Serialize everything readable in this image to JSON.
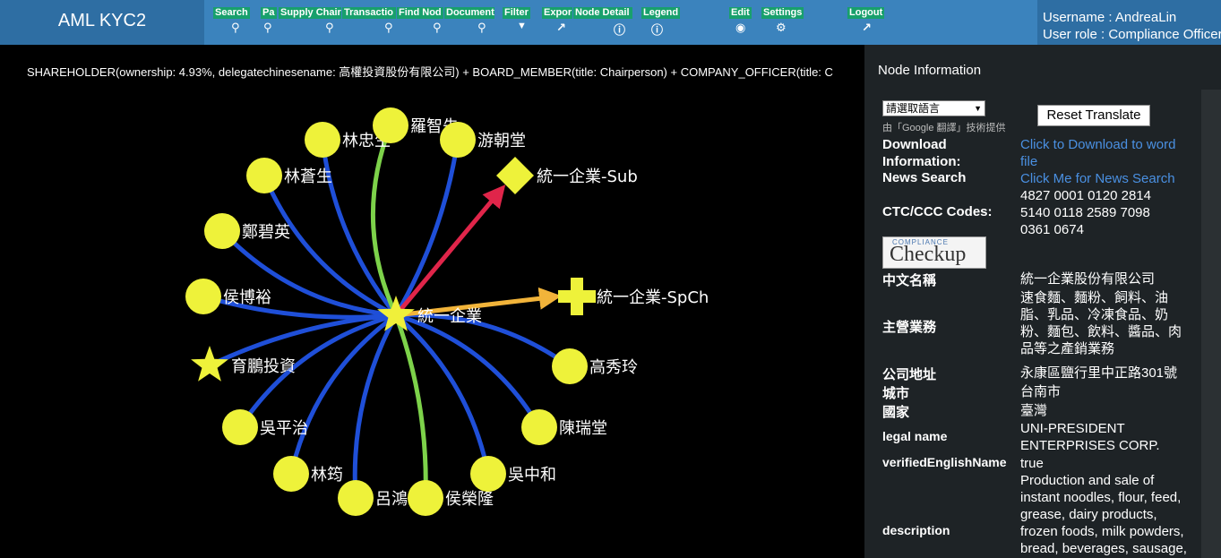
{
  "app": {
    "title": "AML KYC2"
  },
  "toolbar": {
    "items": [
      {
        "label": "Search",
        "icon": "search-icon",
        "glyph": "⚲"
      },
      {
        "label": "Pa",
        "icon": "search-icon",
        "glyph": "⚲"
      },
      {
        "label": "Supply Chair",
        "icon": "search-icon",
        "glyph": "⚲"
      },
      {
        "label": "Transactio",
        "icon": "search-icon",
        "glyph": "⚲"
      },
      {
        "label": "Find Nod",
        "icon": "search-icon",
        "glyph": "⚲"
      },
      {
        "label": "Document",
        "icon": "search-icon",
        "glyph": "⚲"
      },
      {
        "label": "Filter",
        "icon": "filter-icon",
        "glyph": "▼"
      },
      {
        "label": "Expor",
        "icon": "external-link-icon",
        "glyph": "↗"
      },
      {
        "label": "Node Detail",
        "icon": "info-icon",
        "glyph": "ⓘ"
      },
      {
        "label": "Legend",
        "icon": "info-icon",
        "glyph": "ⓘ"
      },
      {
        "label": "Edit",
        "icon": "edit-circle-icon",
        "glyph": "◉"
      },
      {
        "label": "Settings",
        "icon": "gears-icon",
        "glyph": "⚙"
      },
      {
        "label": "Logout",
        "icon": "external-link-icon",
        "glyph": "↗"
      }
    ]
  },
  "user": {
    "username_line": "Username : AndreaLin",
    "role_line": "User role   : Compliance Officer"
  },
  "query_text": "SHAREHOLDER(ownership: 4.93%, delegatechinesename: 高權投資股份有限公司) + BOARD_MEMBER(title: Chairperson) + COMPANY_OFFICER(title: C",
  "graph": {
    "center": {
      "label": "統一企業",
      "color": "#f0f03a"
    },
    "colors": {
      "node": "#eef23a",
      "edge_blue": "#1f4fd8",
      "edge_green": "#7dd24a",
      "edge_red": "#e0254a",
      "edge_orange": "#f2b43a"
    },
    "nodes": [
      {
        "label": "林忠生",
        "shape": "circle"
      },
      {
        "label": "羅智先",
        "shape": "circle"
      },
      {
        "label": "游朝堂",
        "shape": "circle"
      },
      {
        "label": "林蒼生",
        "shape": "circle"
      },
      {
        "label": "鄭碧英",
        "shape": "circle"
      },
      {
        "label": "侯博裕",
        "shape": "circle"
      },
      {
        "label": "育鵬投資",
        "shape": "star"
      },
      {
        "label": "吳平治",
        "shape": "circle"
      },
      {
        "label": "林筠",
        "shape": "circle"
      },
      {
        "label": "呂鴻德",
        "shape": "circle"
      },
      {
        "label": "侯榮隆",
        "shape": "circle"
      },
      {
        "label": "吳中和",
        "shape": "circle"
      },
      {
        "label": "陳瑞堂",
        "shape": "circle"
      },
      {
        "label": "高秀玲",
        "shape": "circle"
      },
      {
        "label": "統一企業-Sub",
        "shape": "diamond"
      },
      {
        "label": "統一企業-SpCh",
        "shape": "cross"
      }
    ]
  },
  "panel": {
    "title": "Node Information",
    "language_select": "請選取語言",
    "powered_by": "由「Google 翻譯」技術提供",
    "reset_button": "Reset Translate",
    "checkup_small": "COMPLIANCE",
    "checkup_big": "Checkup",
    "rows": [
      {
        "label": "Download Information:",
        "value": "Click to Download to word file",
        "link": true
      },
      {
        "label": "News Search",
        "value": "Click Me for News Search",
        "link": true
      },
      {
        "label": "CTC/CCC Codes:",
        "value": "4827 0001 0120 2814 5140 0118 2589 7098 0361 0674",
        "link": false
      },
      {
        "label": "中文名稱",
        "value": "統一企業股份有限公司",
        "link": false
      },
      {
        "label": "主營業務",
        "value": "速食麵、麵粉、飼料、油脂、乳品、冷凍食品、奶粉、麵包、飲料、醬品、肉品等之產銷業務",
        "link": false
      },
      {
        "label": "公司地址",
        "value": "永康區鹽行里中正路301號",
        "link": false
      },
      {
        "label": "城市",
        "value": "台南市",
        "link": false
      },
      {
        "label": "國家",
        "value": "臺灣",
        "link": false
      },
      {
        "label": "legal name",
        "value": "UNI-PRESIDENT ENTERPRISES CORP.",
        "link": false
      },
      {
        "label": "verifiedEnglishName",
        "value": "true",
        "link": false
      },
      {
        "label": "description",
        "value": "Production and sale of instant noodles, flour, feed, grease, dairy products, frozen foods, milk powders, bread, beverages, sausage,",
        "link": false
      }
    ]
  }
}
